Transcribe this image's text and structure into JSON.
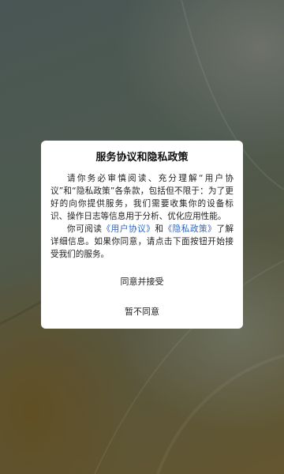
{
  "dialog": {
    "title": "服务协议和隐私政策",
    "paragraph1": "请你务必审慎阅读、充分理解“用户协议”和“隐私政策”各条款，包括但不限于：为了更好的向你提供服务，我们需要收集你的设备标识、操作日志等信息用于分析、优化应用性能。",
    "paragraph2_prefix": "你可阅读",
    "user_agreement_link": "《用户协议》",
    "paragraph2_and": "和",
    "privacy_policy_link": "《隐私政策》",
    "paragraph2_suffix": "了解详细信息。如果你同意，请点击下面按钮开始接受我们的服务。",
    "agree_button": "同意并接受",
    "disagree_button": "暂不同意"
  },
  "colors": {
    "link": "#2a64c8",
    "dialog_background": "#ffffff"
  }
}
